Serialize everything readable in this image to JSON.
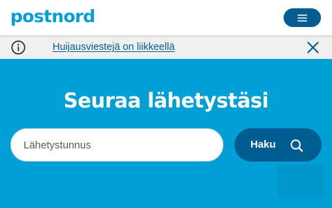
{
  "colors": {
    "brand_blue": "#00a0d6",
    "dark_blue": "#005d92",
    "alert_bg": "#f0f0f0",
    "link_blue": "#005d92"
  },
  "header": {
    "logo_text": "postnord",
    "menu_icon": "hamburger-menu-icon"
  },
  "alert": {
    "info_icon": "info-circle-icon",
    "message": "Huijausviestejä on liikkeellä",
    "close_icon": "close-icon"
  },
  "hero": {
    "title": "Seuraa lähetystäsi",
    "search": {
      "placeholder": "Lähetystunnus",
      "value": "",
      "button_label": "Haku",
      "button_icon": "search-icon"
    }
  }
}
